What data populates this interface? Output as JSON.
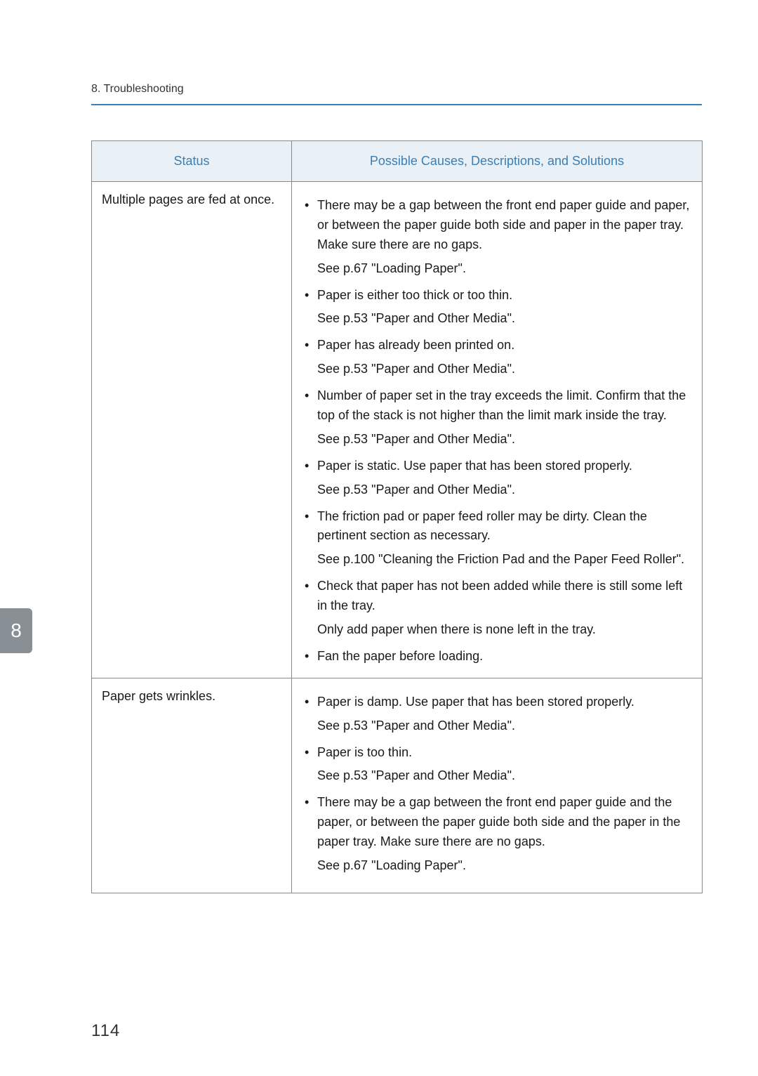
{
  "header": {
    "section": "8. Troubleshooting"
  },
  "chapter_tab": "8",
  "page_number": "114",
  "table": {
    "columns": {
      "status": "Status",
      "solutions": "Possible Causes, Descriptions, and Solutions"
    },
    "rows": [
      {
        "status": "Multiple pages are fed at once.",
        "items": [
          {
            "text": "There may be a gap between the front end paper guide and paper, or between the paper guide both side and paper in the paper tray. Make sure there are no gaps.",
            "sub": "See p.67 \"Loading Paper\"."
          },
          {
            "text": "Paper is either too thick or too thin.",
            "sub": "See p.53 \"Paper and Other Media\"."
          },
          {
            "text": "Paper has already been printed on.",
            "sub": "See p.53 \"Paper and Other Media\"."
          },
          {
            "text": "Number of paper set in the tray exceeds the limit. Confirm that the top of the stack is not higher than the limit mark inside the tray.",
            "sub": "See p.53 \"Paper and Other Media\"."
          },
          {
            "text": "Paper is static. Use paper that has been stored properly.",
            "sub": "See p.53 \"Paper and Other Media\"."
          },
          {
            "text": "The friction pad or paper feed roller may be dirty. Clean the pertinent section as necessary.",
            "sub": "See p.100 \"Cleaning the Friction Pad and the Paper Feed Roller\"."
          },
          {
            "text": "Check that paper has not been added while there is still some left in the tray.",
            "sub": "Only add paper when there is none left in the tray."
          },
          {
            "text": "Fan the paper before loading."
          }
        ]
      },
      {
        "status": "Paper gets wrinkles.",
        "items": [
          {
            "text": "Paper is damp. Use paper that has been stored properly.",
            "sub": "See p.53 \"Paper and Other Media\"."
          },
          {
            "text": "Paper is too thin.",
            "sub": "See p.53 \"Paper and Other Media\"."
          },
          {
            "text": "There may be a gap between the front end paper guide and the paper, or between the paper guide both side and the paper in the paper tray. Make sure there are no gaps.",
            "sub": "See p.67 \"Loading Paper\"."
          }
        ]
      }
    ]
  }
}
